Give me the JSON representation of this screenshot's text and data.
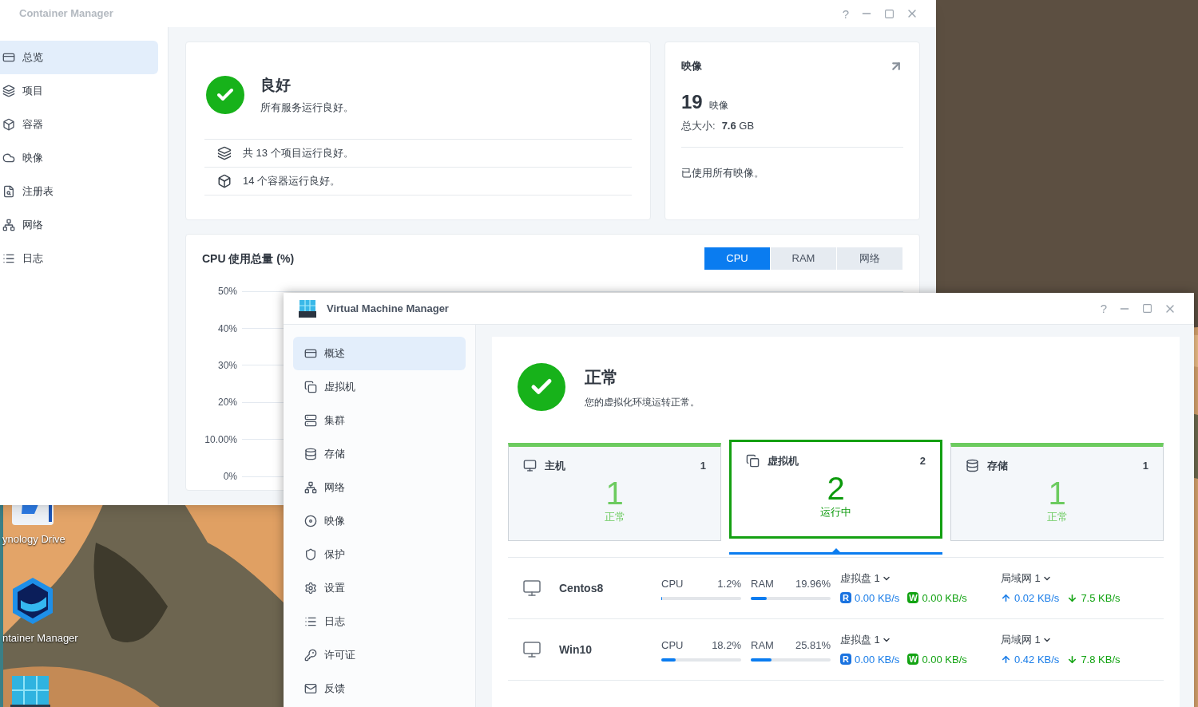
{
  "desktop": {
    "icons": [
      {
        "kind": "drive",
        "label": "ynology Drive"
      },
      {
        "kind": "container",
        "label": "ntainer Manager"
      },
      {
        "kind": "vmm"
      }
    ]
  },
  "container_manager": {
    "title": "Container Manager",
    "help": "?",
    "sidebar": [
      {
        "label": "总览",
        "selected": true
      },
      {
        "label": "项目",
        "selected": false
      },
      {
        "label": "容器",
        "selected": false
      },
      {
        "label": "映像",
        "selected": false
      },
      {
        "label": "注册表",
        "selected": false
      },
      {
        "label": "网络",
        "selected": false
      },
      {
        "label": "日志",
        "selected": false
      }
    ],
    "status": {
      "title": "良好",
      "message": "所有服务运行良好。",
      "lines": [
        {
          "kind": "project",
          "text": "共 13 个项目运行良好。"
        },
        {
          "kind": "container",
          "text": "14 个容器运行良好。"
        }
      ]
    },
    "images_card": {
      "title": "映像",
      "count": "19",
      "count_unit": "映像",
      "size_label": "总大小:",
      "size_value": "7.6",
      "size_unit": "GB",
      "note": "已使用所有映像。"
    },
    "usage": {
      "title": "CPU 使用总量 (%)",
      "tabs": [
        {
          "label": "CPU",
          "selected": true
        },
        {
          "label": "RAM",
          "selected": false
        },
        {
          "label": "网络",
          "selected": false
        }
      ],
      "y_labels": [
        "50%",
        "40%",
        "30%",
        "20%",
        "10.00%",
        "0%"
      ]
    }
  },
  "vm_manager": {
    "title": "Virtual Machine Manager",
    "help": "?",
    "sidebar": [
      {
        "label": "概述",
        "selected": true
      },
      {
        "label": "虚拟机",
        "selected": false
      },
      {
        "label": "集群",
        "selected": false
      },
      {
        "label": "存储",
        "selected": false
      },
      {
        "label": "网络",
        "selected": false
      },
      {
        "label": "映像",
        "selected": false
      },
      {
        "label": "保护",
        "selected": false
      },
      {
        "label": "设置",
        "selected": false
      },
      {
        "label": "日志",
        "selected": false
      },
      {
        "label": "许可证",
        "selected": false
      },
      {
        "label": "反馈",
        "selected": false
      }
    ],
    "status": {
      "title": "正常",
      "message": "您的虚拟化环境运转正常。"
    },
    "summary": [
      {
        "kind": "host",
        "title": "主机",
        "count": "1",
        "big": "1",
        "state": "正常",
        "selected": false
      },
      {
        "kind": "vm",
        "title": "虚拟机",
        "count": "2",
        "big": "2",
        "state": "运行中",
        "selected": true
      },
      {
        "kind": "storage",
        "title": "存储",
        "count": "1",
        "big": "1",
        "state": "正常",
        "selected": false
      }
    ],
    "vms": [
      {
        "name": "Centos8",
        "cpu": {
          "label": "CPU",
          "value": "1.2%",
          "level": 0.012
        },
        "ram": {
          "label": "RAM",
          "value": "19.96%",
          "level": 0.2
        },
        "disk": "虚拟盘 1",
        "read_badge": "R",
        "read": "0.00 KB/s",
        "write_badge": "W",
        "write": "0.00 KB/s",
        "net": "局域网 1",
        "up": "0.02 KB/s",
        "down": "7.5 KB/s"
      },
      {
        "name": "Win10",
        "cpu": {
          "label": "CPU",
          "value": "18.2%",
          "level": 0.182
        },
        "ram": {
          "label": "RAM",
          "value": "25.81%",
          "level": 0.258
        },
        "disk": "虚拟盘 1",
        "read_badge": "R",
        "read": "0.00 KB/s",
        "write_badge": "W",
        "write": "0.00 KB/s",
        "net": "局域网 1",
        "up": "0.42 KB/s",
        "down": "7.8 KB/s"
      }
    ]
  }
}
